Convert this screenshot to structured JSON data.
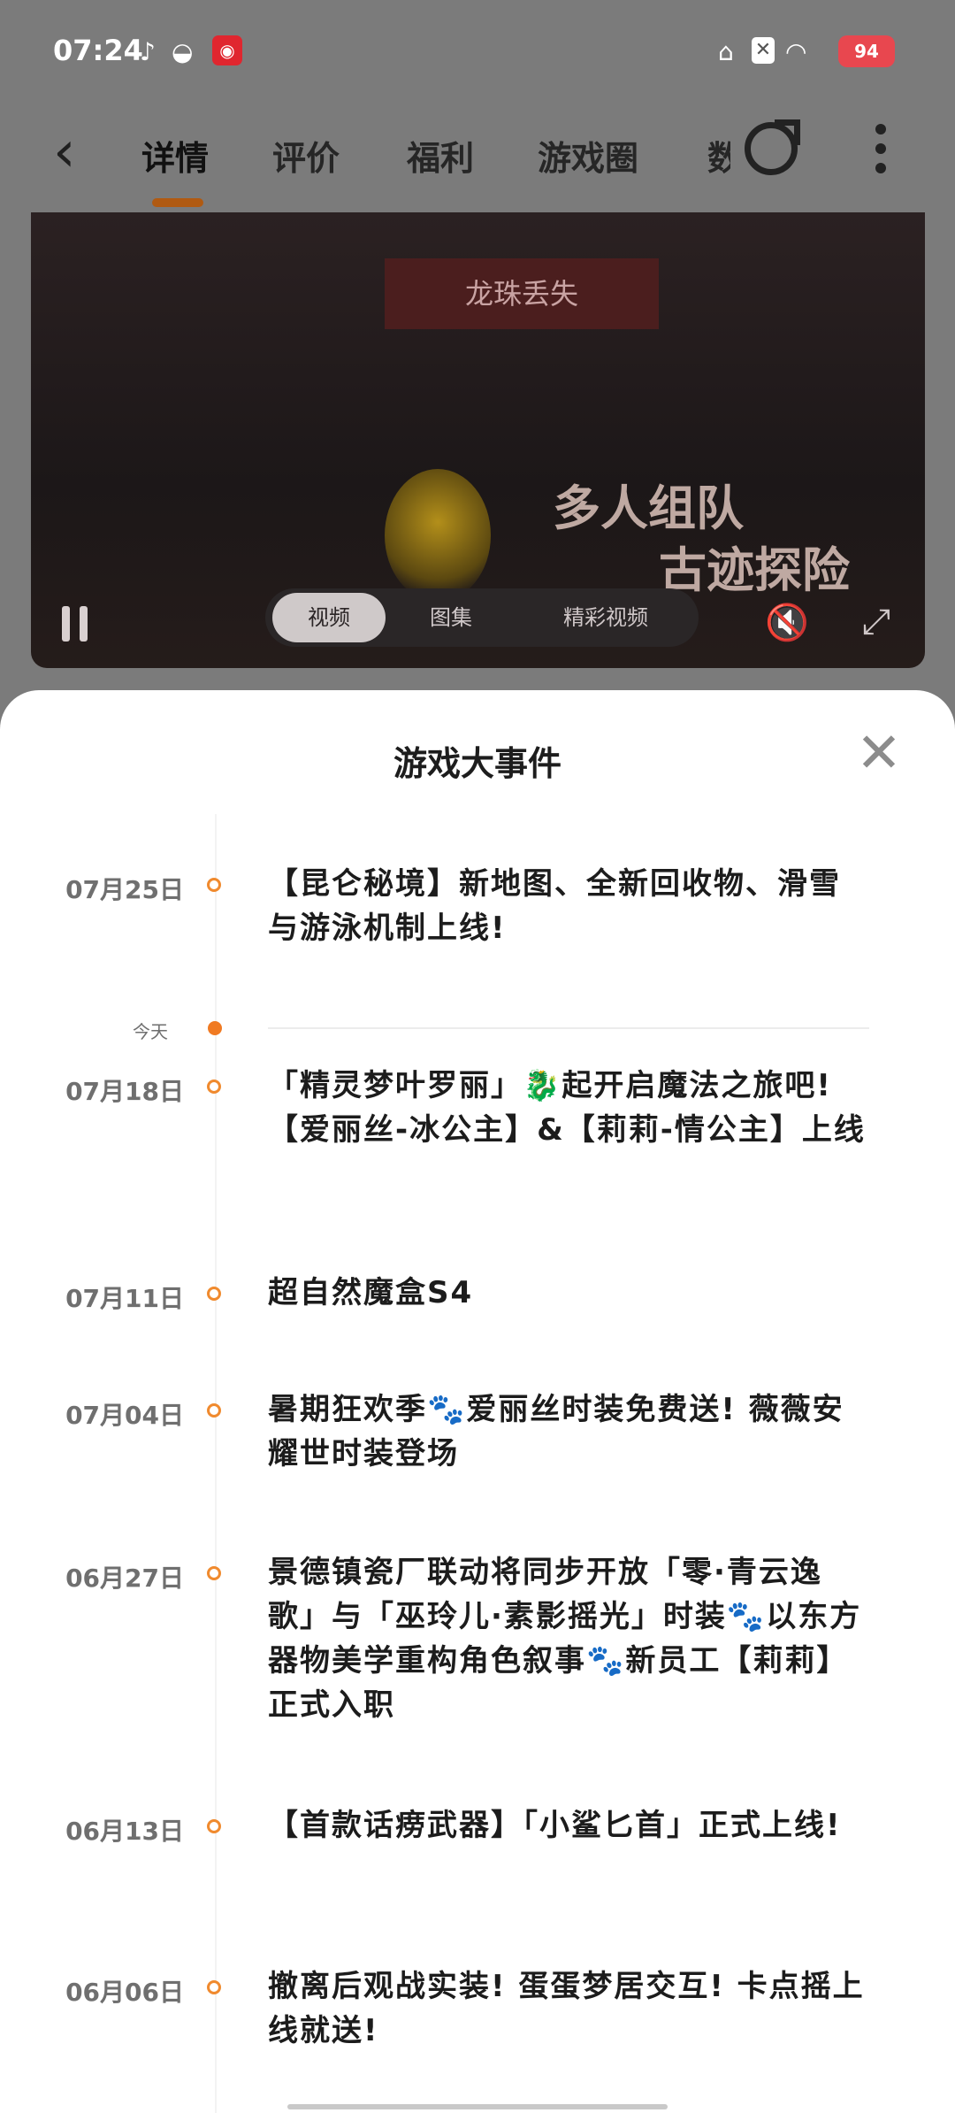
{
  "status_bar": {
    "time": "07:24",
    "battery": "94",
    "icons": [
      "tiktok-icon",
      "wechat-icon",
      "weibo-icon",
      "bell-muted-icon",
      "close-box-icon",
      "wifi-icon",
      "battery-icon"
    ]
  },
  "nav": {
    "tabs": [
      "详情",
      "评价",
      "福利",
      "游戏圈",
      "数"
    ],
    "active_tab": "详情"
  },
  "video": {
    "banner_top": "龙珠丢失",
    "promo_line1": "多人组队",
    "promo_line2": "古迹探险",
    "segments": [
      "视频",
      "图集",
      "精彩视频"
    ],
    "selected_segment": "视频"
  },
  "sheet": {
    "title": "游戏大事件",
    "today_label": "今天",
    "events": [
      {
        "date": "07月25日",
        "text": "【昆仑秘境】新地图、全新回收物、滑雪与游泳机制上线!"
      },
      {
        "date": "07月18日",
        "text": "「精灵梦叶罗丽」🐉起开启魔法之旅吧! 【爱丽丝-冰公主】&【莉莉-情公主】上线"
      },
      {
        "date": "07月11日",
        "text": "超自然魔盒S4"
      },
      {
        "date": "07月04日",
        "text": "暑期狂欢季🐾爱丽丝时装免费送! 薇薇安耀世时装登场"
      },
      {
        "date": "06月27日",
        "text": "景德镇瓷厂联动将同步开放「零·青云逸歌」与「巫玲儿·素影摇光」时装🐾以东方器物美学重构角色叙事🐾新员工【莉莉】正式入职"
      },
      {
        "date": "06月13日",
        "text": "【首款话痨武器】「小鲨匕首」正式上线!"
      },
      {
        "date": "06月06日",
        "text": "撤离后观战实装! 蛋蛋梦居交互! 卡点摇上线就送!"
      }
    ]
  },
  "colors": {
    "accent": "#f08a2e",
    "today_dot": "#f07a22",
    "tab_underline": "#b05a12"
  }
}
